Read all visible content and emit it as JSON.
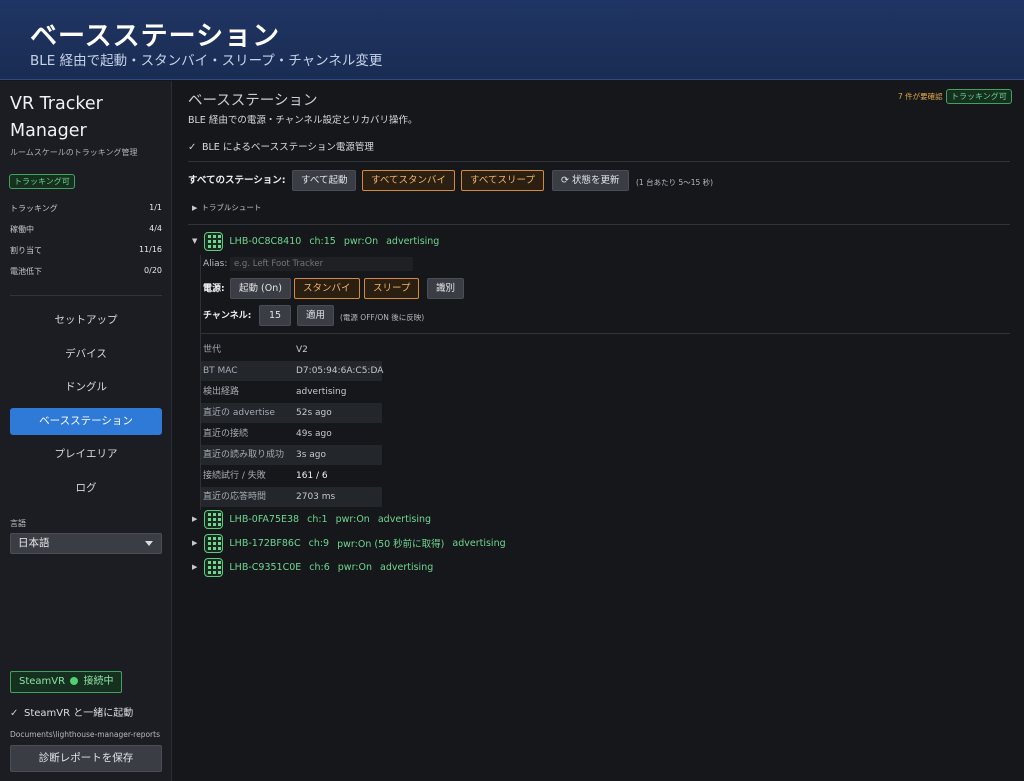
{
  "banner": {
    "title": "ベースステーション",
    "subtitle": "BLE 経由で起動・スタンバイ・スリープ・チャンネル変更"
  },
  "sidebar": {
    "app_title": "VR Tracker Manager",
    "app_subtitle": "ルームスケールのトラッキング管理",
    "status_badge": "トラッキング可",
    "stats": [
      {
        "label": "トラッキング",
        "value": "1/1"
      },
      {
        "label": "稼働中",
        "value": "4/4"
      },
      {
        "label": "割り当て",
        "value": "11/16"
      },
      {
        "label": "電池低下",
        "value": "0/20"
      }
    ],
    "nav": [
      {
        "label": "セットアップ",
        "active": false
      },
      {
        "label": "デバイス",
        "active": false
      },
      {
        "label": "ドングル",
        "active": false
      },
      {
        "label": "ベースステーション",
        "active": true
      },
      {
        "label": "プレイエリア",
        "active": false
      },
      {
        "label": "ログ",
        "active": false
      }
    ],
    "language_label": "言語",
    "language_value": "日本語",
    "steamvr_badge": "SteamVR",
    "steamvr_status": "接続中",
    "launch_with_steamvr": "SteamVR と一緒に起動",
    "report_path": "Documents\\lighthouse-manager-reports",
    "diag_button": "診断レポートを保存"
  },
  "main": {
    "title": "ベースステーション",
    "description": "BLE 経由での電源・チャンネル設定とリカバリ操作。",
    "notice": "7 件が要確認",
    "status_badge": "トラッキング可",
    "ble_checkbox": "BLE によるベースステーション電源管理",
    "all_stations_label": "すべてのステーション:",
    "all_buttons": {
      "start": "すべて起動",
      "standby": "すべてスタンバイ",
      "sleep": "すべてスリープ",
      "refresh": "状態を更新"
    },
    "refresh_hint": "(1 台あたり 5〜15 秒)",
    "troubleshoot": "トラブルシュート",
    "stations": [
      {
        "id": "LHB-0C8C8410",
        "ch": "ch:15",
        "pwr": "pwr:On",
        "state": "advertising",
        "expanded": true
      },
      {
        "id": "LHB-0FA75E38",
        "ch": "ch:1",
        "pwr": "pwr:On",
        "state": "advertising",
        "expanded": false
      },
      {
        "id": "LHB-172BF86C",
        "ch": "ch:9",
        "pwr": "pwr:On (50 秒前に取得)",
        "state": "advertising",
        "expanded": false
      },
      {
        "id": "LHB-C9351C0E",
        "ch": "ch:6",
        "pwr": "pwr:On",
        "state": "advertising",
        "expanded": false
      }
    ],
    "detail": {
      "alias_label": "Alias:",
      "alias_placeholder": "e.g. Left Foot Tracker",
      "power_label": "電源:",
      "power_buttons": {
        "on": "起動 (On)",
        "standby": "スタンバイ",
        "sleep": "スリープ",
        "identify": "識別"
      },
      "channel_label": "チャンネル:",
      "channel_value": "15",
      "apply_button": "適用",
      "channel_hint": "(電源 OFF/ON 後に反映)",
      "info": [
        {
          "k": "世代",
          "v": "V2"
        },
        {
          "k": "BT MAC",
          "v": "D7:05:94:6A:C5:DA"
        },
        {
          "k": "検出経路",
          "v": "advertising"
        },
        {
          "k": "直近の advertise",
          "v": "52s ago"
        },
        {
          "k": "直近の接続",
          "v": "49s ago"
        },
        {
          "k": "直近の読み取り成功",
          "v": "3s ago"
        },
        {
          "k": "接続試行 / 失敗",
          "v": "161 / 6"
        },
        {
          "k": "直近の応答時間",
          "v": "2703 ms"
        }
      ]
    }
  }
}
